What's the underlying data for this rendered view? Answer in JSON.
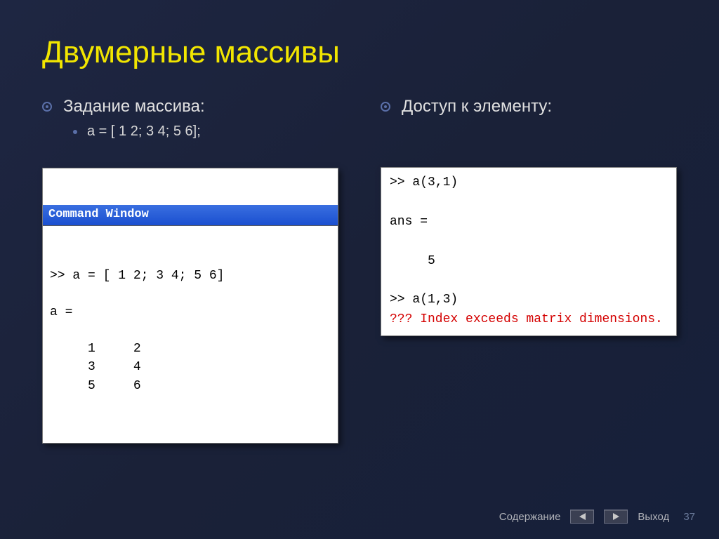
{
  "title": "Двумерные массивы",
  "left": {
    "heading": "Задание массива:",
    "sub": "a = [ 1 2; 3 4; 5 6];",
    "window_title": "Command Window",
    "code": ">> a = [ 1 2; 3 4; 5 6]\n\na =\n\n     1     2\n     3     4\n     5     6"
  },
  "right": {
    "heading": "Доступ к элементу:",
    "code_plain": ">> a(3,1)\n\nans =\n\n     5\n\n>> a(1,3)",
    "code_error": "??? Index exceeds matrix dimensions."
  },
  "footer": {
    "contents": "Содержание",
    "exit": "Выход",
    "page": "37"
  }
}
